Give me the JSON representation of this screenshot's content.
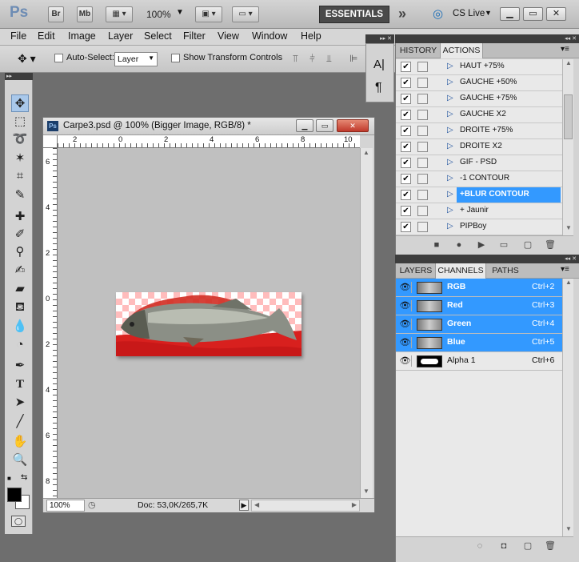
{
  "app": {
    "logo": "Ps",
    "bridge_label": "Br",
    "minibridge_label": "Mb",
    "zoom": "100%",
    "essentials": "ESSENTIALS",
    "more_workspaces": "»",
    "cslive": "CS Live",
    "win_min": "▁",
    "win_max": "▭",
    "win_close": "✕"
  },
  "menu": [
    "File",
    "Edit",
    "Image",
    "Layer",
    "Select",
    "Filter",
    "View",
    "Window",
    "Help"
  ],
  "options": {
    "auto_select_label": "Auto-Select:",
    "auto_select_value": "Layer",
    "show_transform_label": "Show Transform Controls"
  },
  "document": {
    "title": "Carpe3.psd @ 100% (Bigger Image, RGB/8) *",
    "zoom": "100%",
    "doc_info": "Doc: 53,0K/265,7K",
    "hruler_ticks": [
      "2",
      "0",
      "2",
      "4",
      "6",
      "8",
      "10"
    ],
    "vruler_ticks": [
      "6",
      "4",
      "2",
      "0",
      "2",
      "4",
      "6",
      "8"
    ]
  },
  "mini_panel": {
    "character_icon": "A|",
    "paragraph_icon": "¶"
  },
  "actions_panel": {
    "tabs": [
      "HISTORY",
      "ACTIONS"
    ],
    "active_tab": "ACTIONS",
    "items": [
      {
        "label": "HAUT +75%",
        "selected": false
      },
      {
        "label": "GAUCHE +50%",
        "selected": false
      },
      {
        "label": "GAUCHE +75%",
        "selected": false
      },
      {
        "label": "GAUCHE X2",
        "selected": false
      },
      {
        "label": "DROITE +75%",
        "selected": false
      },
      {
        "label": "DROITE X2",
        "selected": false
      },
      {
        "label": "GIF - PSD",
        "selected": false
      },
      {
        "label": "-1 CONTOUR",
        "selected": false
      },
      {
        "label": "+BLUR CONTOUR",
        "selected": true
      },
      {
        "label": "+ Jaunir",
        "selected": false
      },
      {
        "label": "PIPBoy",
        "selected": false
      }
    ]
  },
  "channels_panel": {
    "tabs": [
      "LAYERS",
      "CHANNELS",
      "PATHS"
    ],
    "active_tab": "CHANNELS",
    "channels": [
      {
        "name": "RGB",
        "shortcut": "Ctrl+2",
        "selected": true
      },
      {
        "name": "Red",
        "shortcut": "Ctrl+3",
        "selected": true
      },
      {
        "name": "Green",
        "shortcut": "Ctrl+4",
        "selected": true
      },
      {
        "name": "Blue",
        "shortcut": "Ctrl+5",
        "selected": true
      },
      {
        "name": "Alpha 1",
        "shortcut": "Ctrl+6",
        "selected": false
      }
    ]
  },
  "colors": {
    "accent": "#3399ff",
    "chrome": "#d6d6d6",
    "workspace": "#6e6e6e"
  }
}
